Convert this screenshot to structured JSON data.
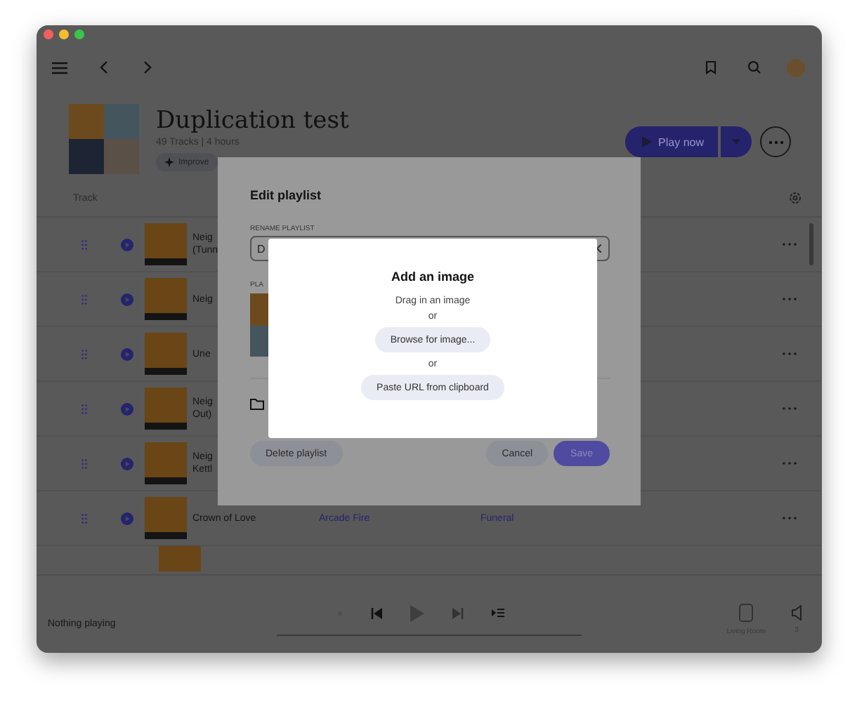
{
  "playlist": {
    "title": "Duplication test",
    "subtitle": "49 Tracks | 4 hours",
    "improve_label": "Improve",
    "play_label": "Play now"
  },
  "table": {
    "columns": [
      "Track"
    ],
    "rows": [
      {
        "title_lines": [
          "Neig",
          "(Tunn"
        ]
      },
      {
        "title_lines": [
          "Neig"
        ]
      },
      {
        "title_lines": [
          "Une"
        ]
      },
      {
        "title_lines": [
          "Neig",
          "Out)"
        ]
      },
      {
        "title_lines": [
          "Neig",
          "Kettl"
        ]
      },
      {
        "title_lines": [
          "Crown of Love"
        ],
        "artist": "Arcade Fire",
        "album": "Funeral"
      }
    ]
  },
  "player": {
    "status": "Nothing playing",
    "device": "Living Room",
    "volume": "3"
  },
  "edit_dialog": {
    "title": "Edit playlist",
    "rename_label": "RENAME PLAYLIST",
    "name_value": "D",
    "image_label": "PLA",
    "buttons": [
      {
        "label": "Delete playlist",
        "kind": "secondary"
      },
      {
        "label": "Cancel",
        "kind": "secondary"
      },
      {
        "label": "Save",
        "kind": "primary"
      }
    ]
  },
  "add_image": {
    "title": "Add an image",
    "items": [
      {
        "kind": "text",
        "text": "Drag in an image"
      },
      {
        "kind": "text",
        "text": "or"
      },
      {
        "kind": "button",
        "text": "Browse for image..."
      },
      {
        "kind": "text",
        "text": "or"
      },
      {
        "kind": "button",
        "text": "Paste URL from clipboard"
      }
    ]
  }
}
